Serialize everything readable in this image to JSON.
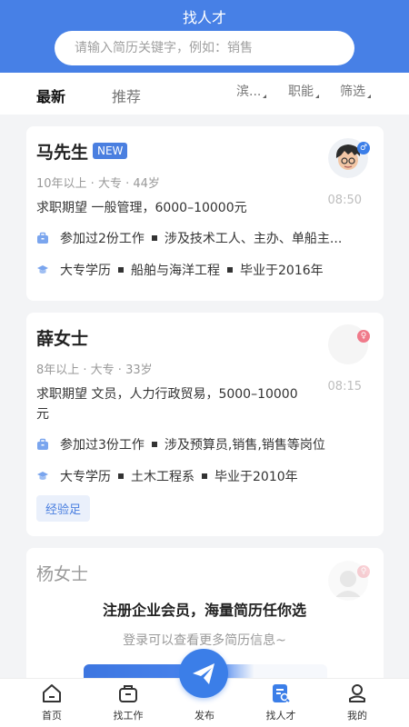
{
  "header": {
    "title": "找人才"
  },
  "search": {
    "placeholder": "请输入简历关键字，例如：销售"
  },
  "tabs": [
    {
      "label": "最新",
      "active": true
    },
    {
      "label": "推荐",
      "active": false
    }
  ],
  "filters": [
    {
      "label": "滨..."
    },
    {
      "label": "职能"
    },
    {
      "label": "筛选"
    }
  ],
  "cards": [
    {
      "name": "马先生",
      "badge": "NEW",
      "meta": "10年以上 · 大专 · 44岁",
      "expect": "求职期望 一般管理，6000–10000元",
      "time": "08:50",
      "gender": "♂",
      "work": {
        "summary": "参加过2份工作",
        "detail": "涉及技术工人、主办、单船主..."
      },
      "edu": {
        "level": "大专学历",
        "major": "船舶与海洋工程",
        "grad": "毕业于2016年"
      }
    },
    {
      "name": "薛女士",
      "meta": "8年以上 · 大专 · 33岁",
      "expect": "求职期望 文员，人力行政贸易，5000–10000元",
      "time": "08:15",
      "gender": "♀",
      "work": {
        "summary": "参加过3份工作",
        "detail": "涉及预算员,销售,销售等岗位"
      },
      "edu": {
        "level": "大专学历",
        "major": "土木工程系",
        "grad": "毕业于2010年"
      },
      "tag": "经验足"
    },
    {
      "name": "杨女士"
    }
  ],
  "overlay": {
    "title": "注册企业会员，海量简历任你选",
    "hint": "登录可以查看更多简历信息~"
  },
  "nav": [
    {
      "label": "首页"
    },
    {
      "label": "找工作"
    },
    {
      "label": "发布"
    },
    {
      "label": "找人才"
    },
    {
      "label": "我的"
    }
  ],
  "colors": {
    "primary": "#4780e6",
    "male_badge": "#3b7ee8",
    "female_badge": "#f07a8a"
  }
}
